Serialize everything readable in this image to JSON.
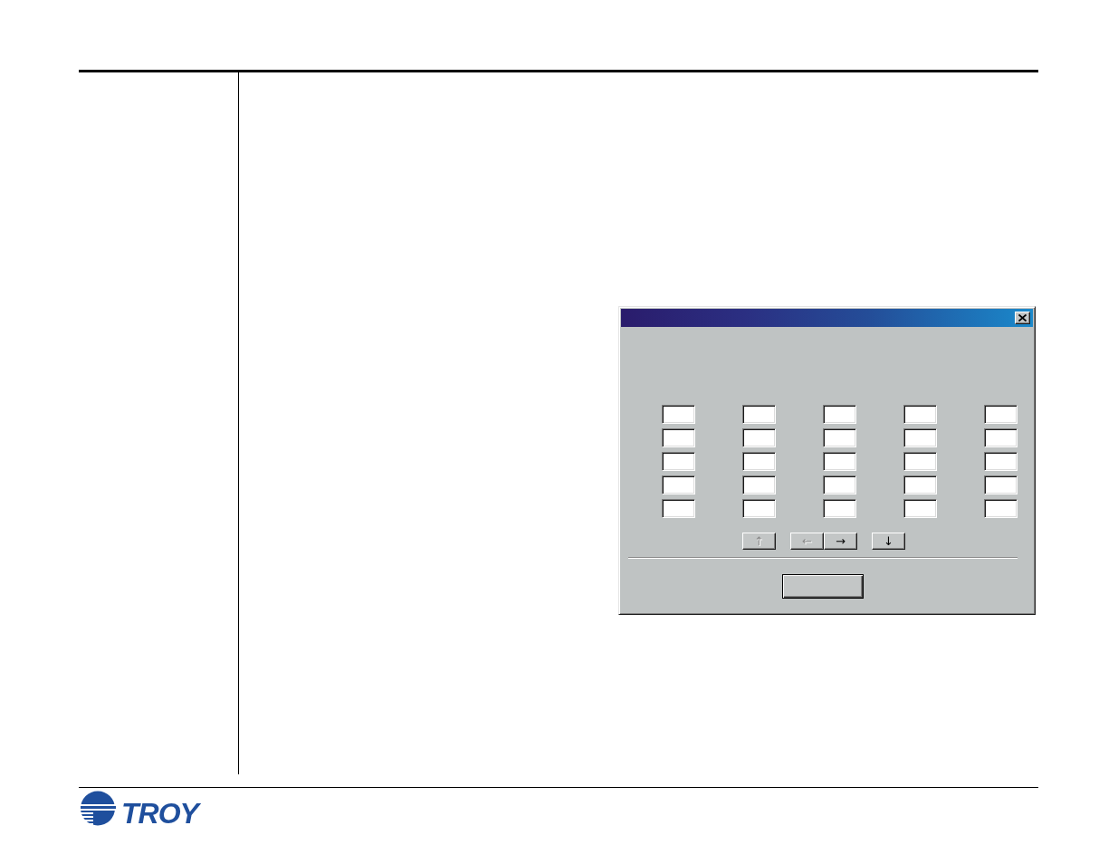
{
  "dialog": {
    "nav_button_groups": [
      [
        {
          "label": "↑",
          "disabled": true
        }
      ],
      [
        {
          "label": "←",
          "disabled": true
        },
        {
          "label": "→",
          "disabled": false
        }
      ],
      [
        {
          "label": "↓",
          "disabled": false
        }
      ]
    ]
  },
  "footer": {
    "logo_text": "TROY"
  }
}
